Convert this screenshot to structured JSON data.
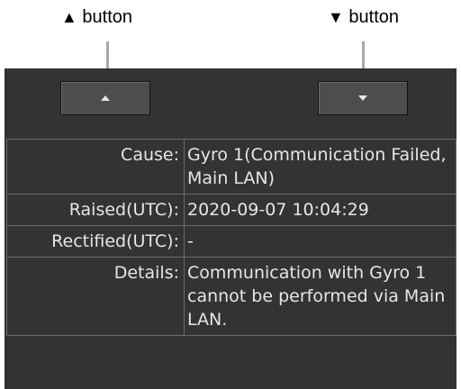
{
  "callouts": {
    "up": {
      "glyph": "▲",
      "text": "button"
    },
    "down": {
      "glyph": "▼",
      "text": "button"
    }
  },
  "buttons": {
    "up_icon": "triangle-up-icon",
    "down_icon": "triangle-down-icon"
  },
  "details": [
    {
      "label": "Cause:",
      "value": "Gyro 1(Communication Failed, Main LAN)"
    },
    {
      "label": "Raised(UTC):",
      "value": "2020-09-07 10:04:29"
    },
    {
      "label": "Rectified(UTC):",
      "value": "-"
    },
    {
      "label": "Details:",
      "value": "Communication with Gyro 1 cannot be performed via Main LAN."
    }
  ],
  "colors": {
    "panel_bg": "#333333",
    "button_bg": "#4d4d4d",
    "grid_line": "#6b6b6b",
    "text": "#e6e6e6"
  }
}
